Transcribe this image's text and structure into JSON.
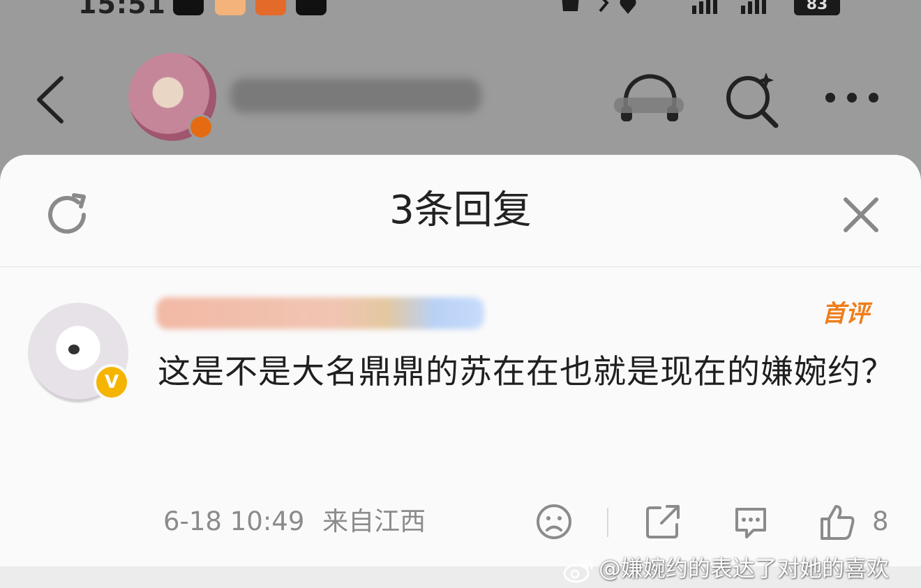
{
  "status_bar": {
    "time": "15:51",
    "battery": "83"
  },
  "sheet": {
    "title": "3条回复"
  },
  "comment": {
    "badge": "首评",
    "text": "这是不是大名鼎鼎的苏在在也就是现在的嫌婉约？",
    "date": "6-18 10:49",
    "location": "来自江西",
    "likes": "8"
  },
  "watermark": "@嫌婉约的表达了对她的喜欢",
  "colors": {
    "accent_orange": "#ef7d1a",
    "verified_yellow": "#f5b400",
    "dim_overlay": "#9b9b9b"
  },
  "icons": [
    "refresh-icon",
    "close-icon",
    "sad-face-icon",
    "share-icon",
    "comment-icon",
    "thumbs-up-icon",
    "back-arrow-icon",
    "search-icon",
    "more-icon",
    "listen-icon",
    "weibo-logo-icon"
  ]
}
